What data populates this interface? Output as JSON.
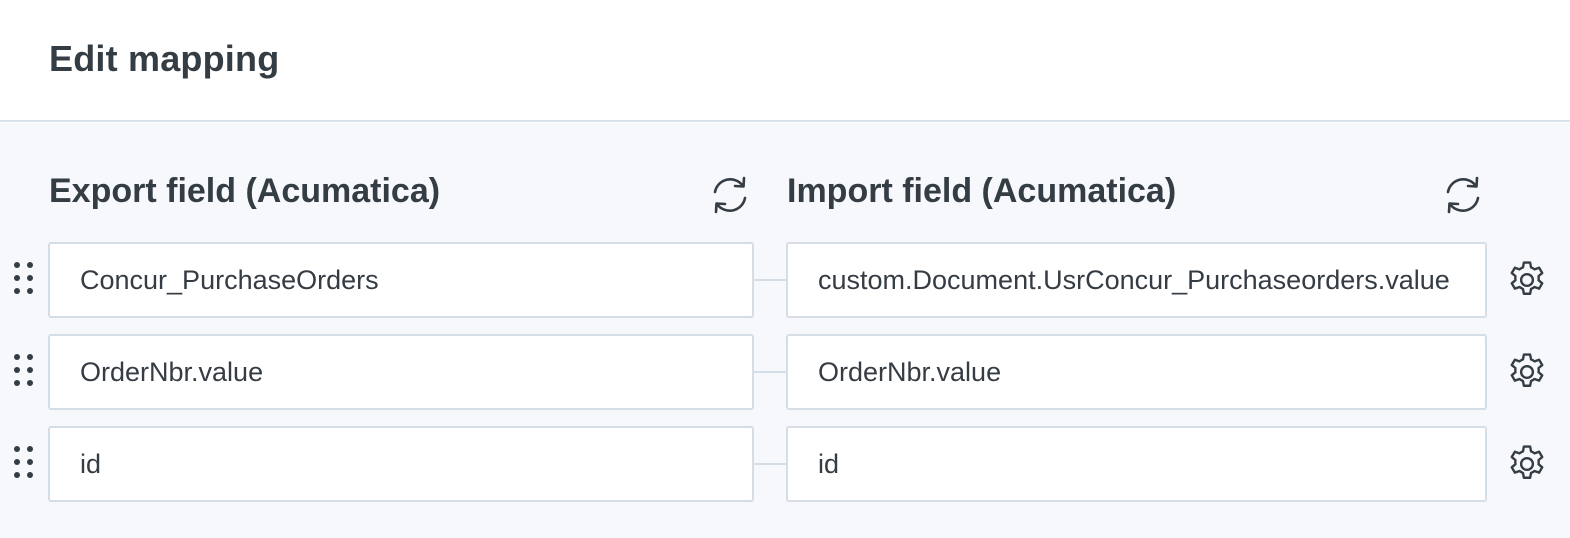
{
  "header": {
    "title": "Edit mapping"
  },
  "columns": {
    "export_label": "Export field (Acumatica)",
    "import_label": "Import field (Acumatica)"
  },
  "rows": [
    {
      "export": "Concur_PurchaseOrders",
      "import": "custom.Document.UsrConcur_Purchaseorders.value"
    },
    {
      "export": "OrderNbr.value",
      "import": "OrderNbr.value"
    },
    {
      "export": "id",
      "import": "id"
    }
  ],
  "icons": {
    "refresh": "refresh-icon",
    "settings": "gear-icon",
    "drag": "drag-handle-icon"
  },
  "colors": {
    "panel_background": "#f6f8fc",
    "field_border": "#d5dee6",
    "text": "#343c44",
    "icon": "#343c44"
  }
}
